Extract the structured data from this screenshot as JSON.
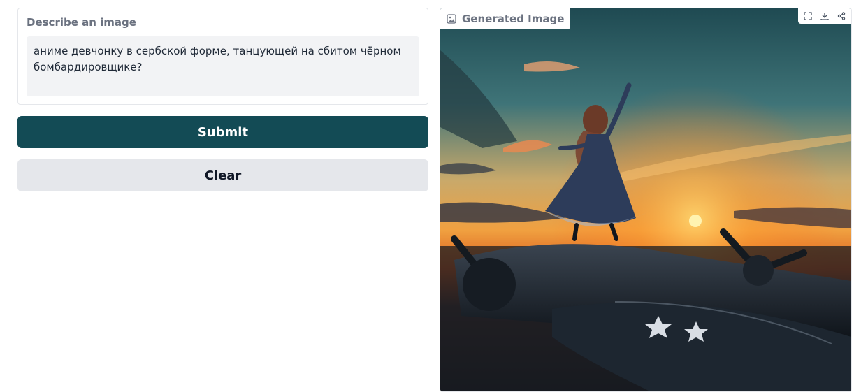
{
  "prompt": {
    "label": "Describe an image",
    "value": "аниме девчонку в сербской форме, танцующей на сбитом чёрном бомбардировщике?"
  },
  "buttons": {
    "submit_label": "Submit",
    "clear_label": "Clear"
  },
  "output": {
    "label": "Generated Image",
    "label_icon": "image-icon",
    "toolbar_icons": [
      "fullscreen-icon",
      "download-icon",
      "share-icon"
    ]
  },
  "colors": {
    "submit_bg": "#134b55",
    "clear_bg": "#e5e7eb"
  }
}
